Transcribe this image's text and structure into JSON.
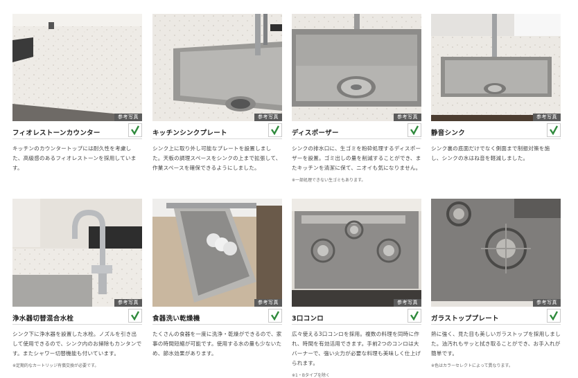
{
  "badge_label": "参考写真",
  "cards": [
    {
      "title": "フィオレストーンカウンター",
      "description": "キッチンのカウンタートップには耐久性を考慮した、高級感のあるフィオレストーンを採用しています。",
      "note": ""
    },
    {
      "title": "キッチンシンクプレート",
      "description": "シンク上に取り外し可能なプレートを設置しました。天板の調理スペースをシンクの上まで拡張して、作業スペースを確保できるようにしました。",
      "note": ""
    },
    {
      "title": "ディスポーザー",
      "description": "シンクの排水口に、生ゴミを粉砕処理するディスポーザーを設置。ゴミ出しの量を削減することができ、またキッチンを清潔に保て、ニオイも気になりません。",
      "note": "※一部処理できない生ゴミもあります。"
    },
    {
      "title": "静音シンク",
      "description": "シンク裏の底面だけでなく側面まで制振対策を施し、シンクの水はね音を軽減しました。",
      "note": ""
    },
    {
      "title": "浄水器切替混合水栓",
      "description": "シンク下に浄水器を設置した水栓。ノズルを引き出して使用できるので、シンク内のお掃除もカンタンです。またシャワー切替機能も付いています。",
      "note": "※定期的なカートリッジ有償交換が必要です。"
    },
    {
      "title": "食器洗い乾燥機",
      "description": "たくさんの食器を一度に洗浄・乾燥ができるので、家事の時間短縮が可能です。使用する水の量も少ないため、節水効果があります。",
      "note": ""
    },
    {
      "title": "3口コンロ",
      "description": "広々使える3口コンロを採用。複数の料理を同時に作れ、時間を有効活用できます。手前2つのコンロは大バーナーで、強い火力が必要な料理も美味しく仕上げられます。",
      "note": "※1・Bタイプを除く"
    },
    {
      "title": "ガラストッププレート",
      "description": "熱に強く、見た目も美しいガラストップを採用しました。油汚れもサッと拭き取ることができ、お手入れが簡単です。",
      "note": "※色はカラーセレクトによって異なります。"
    }
  ]
}
